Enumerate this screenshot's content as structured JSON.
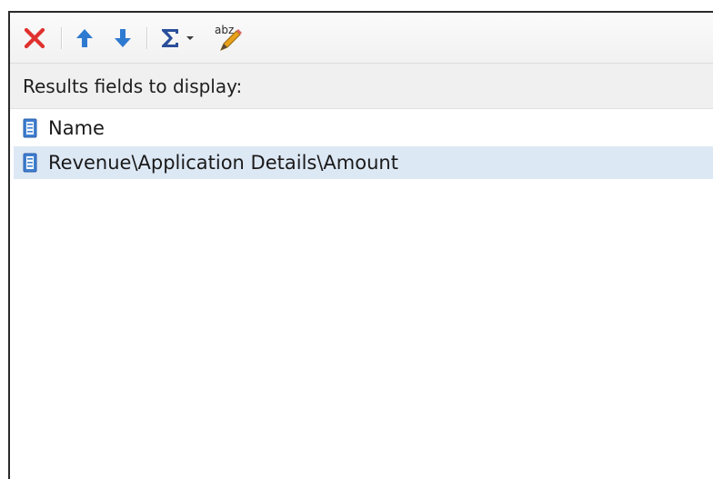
{
  "section": {
    "header": "Results fields to display:"
  },
  "fields": [
    {
      "label": "Name"
    },
    {
      "label": "Revenue\\Application Details\\Amount"
    }
  ],
  "icons": {
    "remove": "x-icon",
    "move_up": "arrow-up-icon",
    "move_down": "arrow-down-icon",
    "summarize": "sigma-icon",
    "rename": "abz-pencil-icon",
    "field": "field-icon"
  },
  "colors": {
    "remove": "#e0312e",
    "arrow": "#2e7ad0",
    "sigma": "#2a4f9a",
    "selection": "#dde8f5"
  }
}
